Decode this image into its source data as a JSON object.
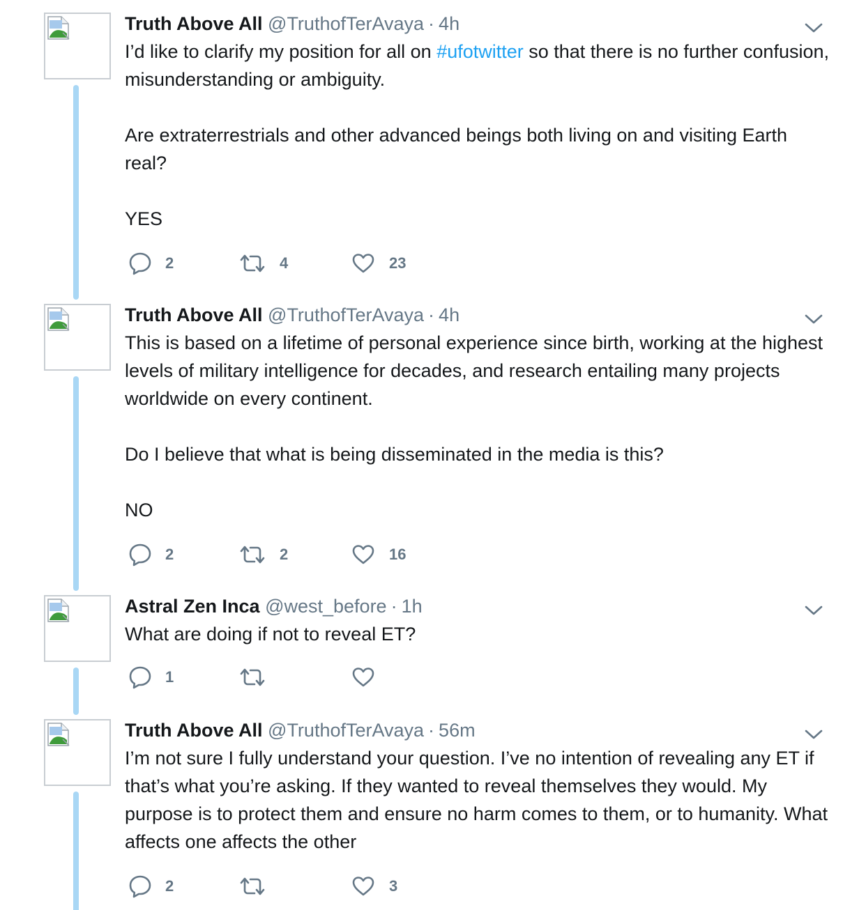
{
  "tweets": [
    {
      "name": "Truth Above All",
      "handle": "@TruthofTerAvaya",
      "separator": "·",
      "time": "4h",
      "paragraphs": [
        [
          "I’d like to clarify my position for all on ",
          "#ufotwitter",
          " so that there is no further confusion, misunderstanding or ambiguity."
        ],
        [
          "Are extraterrestrials and other advanced beings both living on and visiting Earth real?"
        ],
        [
          "YES"
        ]
      ],
      "replies": "2",
      "retweets": "4",
      "likes": "23"
    },
    {
      "name": "Truth Above All",
      "handle": "@TruthofTerAvaya",
      "separator": "·",
      "time": "4h",
      "paragraphs": [
        [
          "This is based on a lifetime of personal experience since birth, working at the highest levels of military intelligence for decades, and research entailing many projects worldwide on every continent."
        ],
        [
          "Do I believe that what is being disseminated in the media is this?"
        ],
        [
          "NO"
        ]
      ],
      "replies": "2",
      "retweets": "2",
      "likes": "16"
    },
    {
      "name": "Astral Zen Inca",
      "handle": "@west_before",
      "separator": "·",
      "time": "1h",
      "paragraphs": [
        [
          "What are doing if not to reveal ET?"
        ]
      ],
      "replies": "1",
      "retweets": "",
      "likes": ""
    },
    {
      "name": "Truth Above All",
      "handle": "@TruthofTerAvaya",
      "separator": "·",
      "time": "56m",
      "paragraphs": [
        [
          "I’m not sure I fully understand your question. I’ve no intention of revealing any ET if that’s what you’re asking. If they wanted to reveal themselves they would. My purpose is to protect them and ensure no harm comes to them, or to humanity. What affects one affects the other"
        ]
      ],
      "replies": "2",
      "retweets": "",
      "likes": "3"
    }
  ],
  "icons": {
    "reply": "reply-icon",
    "retweet": "retweet-icon",
    "like": "like-icon",
    "more": "chevron-down-icon",
    "avatar": "broken-image-icon"
  },
  "colors": {
    "thread_line": "#a9d7f5",
    "hashtag": "#1da1f2",
    "secondary_text": "#657786",
    "icon_gray": "#657786"
  }
}
